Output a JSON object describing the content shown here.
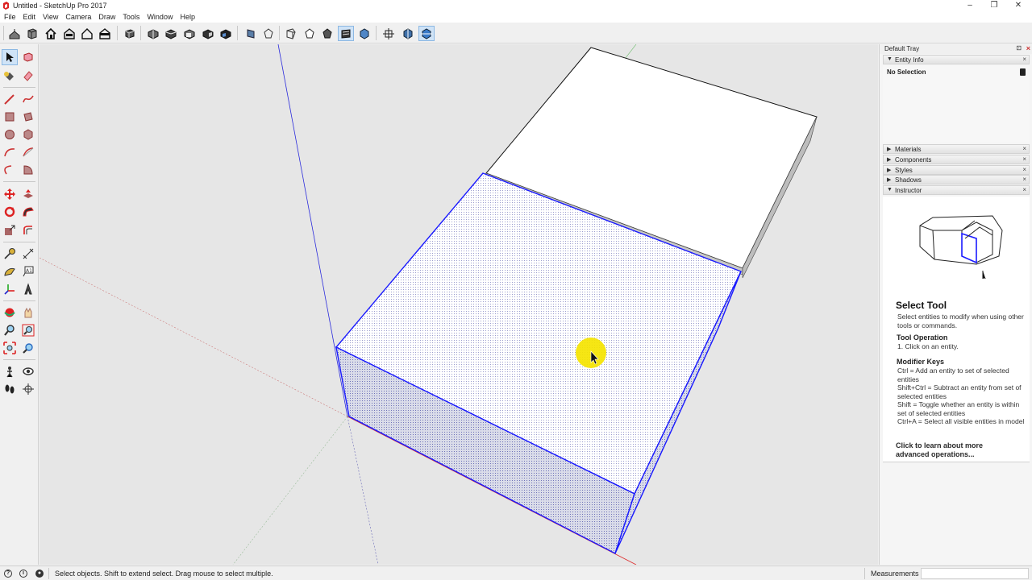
{
  "window": {
    "title": "Untitled - SketchUp Pro 2017",
    "controls": [
      "–",
      "❐",
      "✕"
    ]
  },
  "menu": [
    "File",
    "Edit",
    "View",
    "Camera",
    "Draw",
    "Tools",
    "Window",
    "Help"
  ],
  "toolbar": {
    "icons": [
      "move-camera-icon",
      "cube-icon",
      "house-icon",
      "house-open-icon",
      "house-outline-icon",
      "house-section-icon",
      "box-icon",
      "views-iso-icon",
      "views-top-icon",
      "views-front-icon",
      "views-right-icon",
      "views-back-icon",
      "xray-icon",
      "hidden-line-icon",
      "wireframe-icon",
      "shaded-icon",
      "shaded-textures-icon",
      "monochrome-icon",
      "section-plane-icon",
      "display-section-icon",
      "section-cut-icon"
    ],
    "active": [
      "shaded-textures-icon",
      "section-cut-icon"
    ]
  },
  "tools": {
    "icons": [
      "select-icon",
      "make-component-icon",
      "paint-bucket-icon",
      "eraser-icon",
      "line-icon",
      "freehand-icon",
      "rectangle-icon",
      "rotated-rectangle-icon",
      "circle-icon",
      "polygon-icon",
      "arc-icon",
      "two-point-arc-icon",
      "three-point-arc-icon",
      "pie-icon",
      "move-icon",
      "push-pull-icon",
      "rotate-icon",
      "follow-me-icon",
      "scale-icon",
      "offset-icon",
      "tape-measure-icon",
      "dimension-icon",
      "protractor-icon",
      "text-icon",
      "axes-icon",
      "3d-text-icon",
      "orbit-icon",
      "pan-icon",
      "zoom-icon",
      "zoom-window-icon",
      "zoom-extents-icon",
      "previous-view-icon",
      "position-camera-icon",
      "look-around-icon",
      "walk-icon",
      "section-plane-tool-icon"
    ],
    "active": "select-icon",
    "text_icon_label": "A1"
  },
  "tray": {
    "title": "Default Tray",
    "pin": "⊡",
    "close": "×",
    "entity_info": {
      "label": "Entity Info",
      "selection": "No Selection"
    },
    "collapsed_panels": [
      "Materials",
      "Components",
      "Styles",
      "Shadows"
    ],
    "instructor": {
      "label": "Instructor",
      "tool_title": "Select Tool",
      "tool_desc": "Select entities to modify when using other tools or commands.",
      "op_heading": "Tool Operation",
      "op_steps": "1. Click on an entity.",
      "mod_heading": "Modifier Keys",
      "mod_lines": [
        "Ctrl = Add an entity to set of selected entities",
        "Shift+Ctrl = Subtract an entity from set of selected entities",
        "Shift = Toggle whether an entity is within set of selected entities",
        "Ctrl+A = Select all visible entities in model"
      ],
      "learn_more": "Click to learn about more advanced operations..."
    }
  },
  "status": {
    "message": "Select objects. Shift to extend select. Drag mouse to select multiple.",
    "measurements_label": "Measurements",
    "measurements_value": ""
  }
}
